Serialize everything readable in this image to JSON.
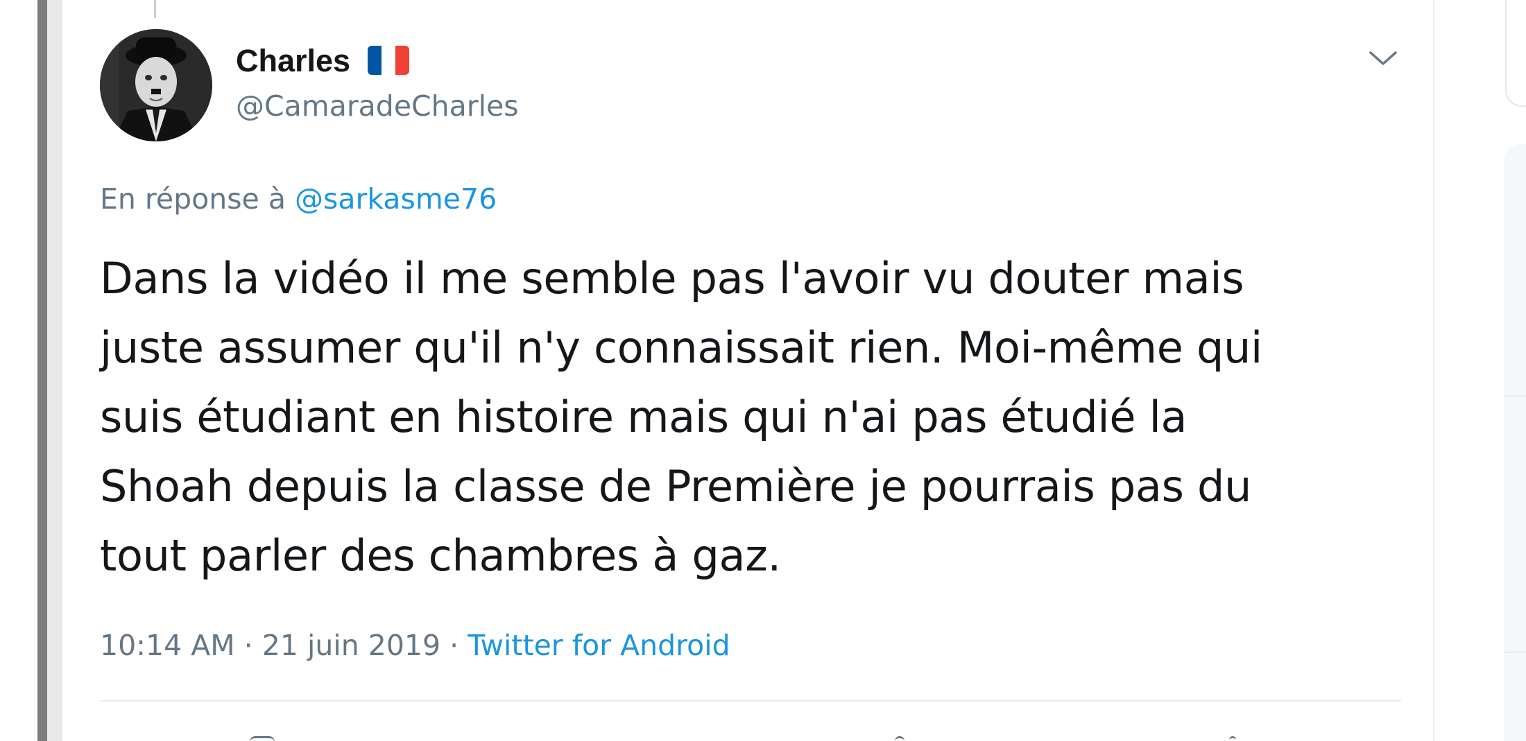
{
  "tweet": {
    "author": {
      "display_name": "Charles",
      "handle": "@CamaradeCharles",
      "flag_colors": [
        "#0055a4",
        "#ffffff",
        "#ef4135"
      ]
    },
    "reply": {
      "prefix": "En réponse à",
      "target": "@sarkasme76"
    },
    "text_lines": [
      "Dans la vidéo il me semble pas l'avoir vu douter mais",
      "juste assumer qu'il n'y connaissait rien. Moi-même qui",
      "suis étudiant en histoire mais qui n'ai pas étudié la",
      "Shoah depuis la classe de Première je pourrais pas du",
      "tout parler des chambres à gaz."
    ],
    "meta": {
      "time": "10:14 AM",
      "sep1": "·",
      "date": "21 juin 2019",
      "sep2": "·",
      "source": "Twitter for Android"
    }
  },
  "icons": {
    "more": "chevron-down-icon",
    "flag": "french-flag-icon"
  },
  "colors": {
    "link": "#1b95e0",
    "secondary_text": "#657786",
    "primary_text": "#14171a"
  }
}
